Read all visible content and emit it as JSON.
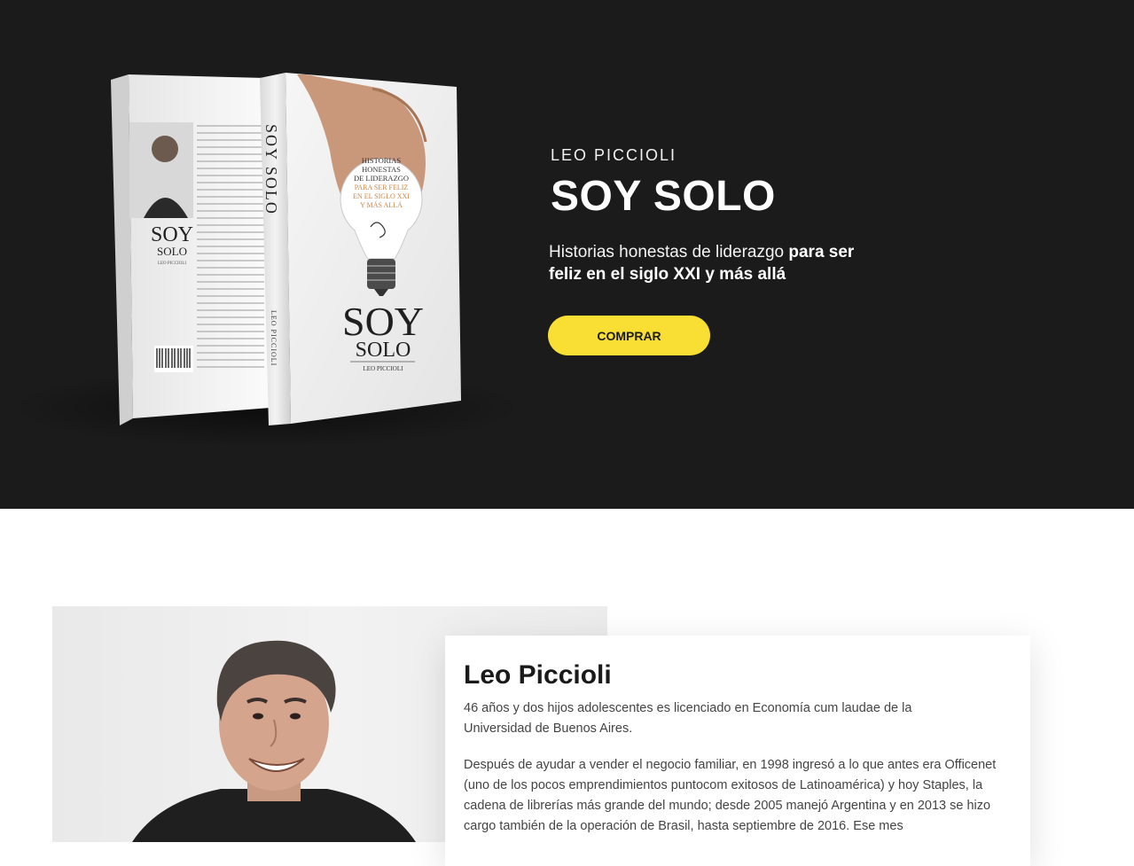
{
  "hero": {
    "author": "LEO PICCIOLI",
    "title": "SOY SOLO",
    "subtitle_regular": "Historias honestas de liderazgo ",
    "subtitle_bold": "para ser feliz en el siglo XXI y más allá",
    "cta_label": "COMPRAR",
    "cta_color": "#f9de33",
    "background": "#1c1b1b"
  },
  "book_cover": {
    "spine_title": "SOY SOLO",
    "spine_author": "LEO PICCIOLI",
    "bulb_lines": [
      "HISTORIAS",
      "HONESTAS",
      "DE LIDERAZGO"
    ],
    "bulb_accent_lines": [
      "PARA SER FELIZ",
      "EN EL SIGLO XXI",
      "Y MÁS ALLÁ"
    ],
    "front_title_1": "SOY",
    "front_title_2": "SOLO",
    "front_author": "LEO PICCIOLI"
  },
  "back_cover": {
    "title_1": "SOY",
    "title_2": "SOLO",
    "author": "LEO PICCIOLI"
  },
  "bio": {
    "name": "Leo Piccioli",
    "paragraph_1": "46 años y dos hijos adolescentes es licenciado en Economía cum laudae de la Universidad de Buenos Aires.",
    "paragraph_2": "Después de ayudar a vender el negocio familiar, en 1998 ingresó a lo que antes era Officenet (uno de los pocos emprendimientos puntocom exitosos de Latinoamérica) y hoy Staples, la cadena de librerías más grande del mundo; desde 2005 manejó Argentina y en 2013 se hizo cargo también de la operación de Brasil, hasta septiembre de 2016. Ese mes"
  }
}
